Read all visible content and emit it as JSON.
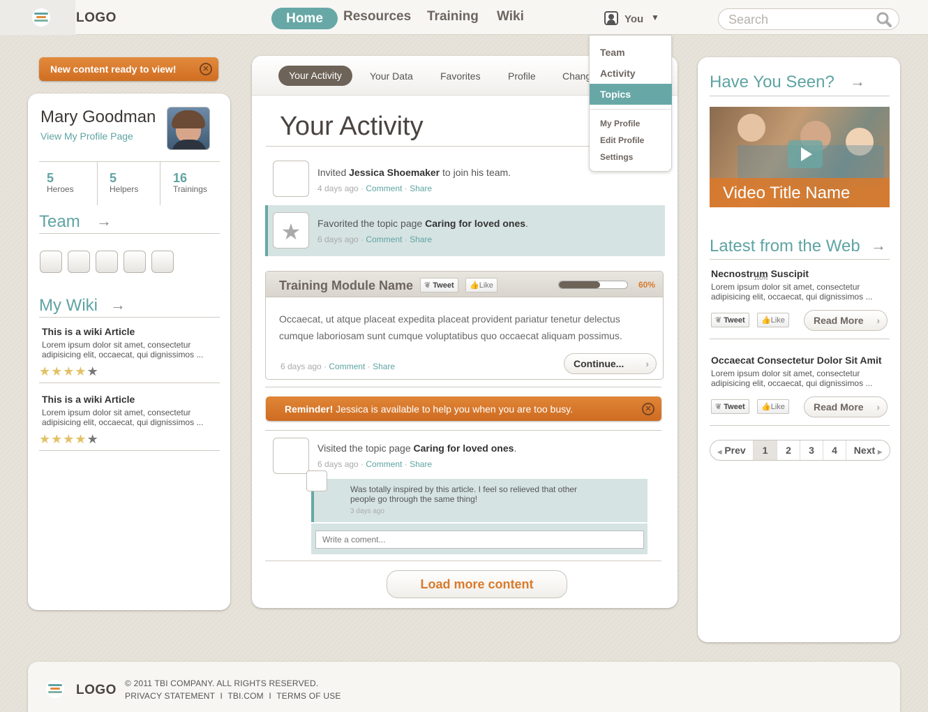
{
  "header": {
    "logo": "LOGO",
    "nav": [
      "Home",
      "Resources",
      "Training",
      "Wiki"
    ],
    "user": "You",
    "search_placeholder": "Search"
  },
  "dropdown": {
    "items": [
      "Team",
      "Activity",
      "Topics"
    ],
    "sub_items": [
      "My Profile",
      "Edit Profile",
      "Settings"
    ],
    "active": "Topics"
  },
  "notice": {
    "text": "New content ready to view!"
  },
  "profile": {
    "name": "Mary Goodman",
    "link": "View My Profile Page",
    "stats": [
      {
        "value": "5",
        "label": "Heroes"
      },
      {
        "value": "5",
        "label": "Helpers"
      },
      {
        "value": "16",
        "label": "Trainings"
      }
    ],
    "team_title": "Team",
    "wiki_title": "My Wiki",
    "wiki_articles": [
      {
        "title": "This is a wiki Article",
        "body": "Lorem ipsum dolor sit amet, consectetur adipisicing elit, occaecat, qui dignissimos ...",
        "rating": 4,
        "max": 5
      },
      {
        "title": "This is a wiki Article",
        "body": "Lorem ipsum dolor sit amet, consectetur adipisicing elit, occaecat, qui dignissimos ...",
        "rating": 4,
        "max": 5
      }
    ]
  },
  "tabs": [
    "Your Activity",
    "Your Data",
    "Favorites",
    "Profile",
    "Chang"
  ],
  "main": {
    "title": "Your Activity",
    "activity1": {
      "pre": "Invited ",
      "bold": "Jessica Shoemaker",
      "post": " to join his team.",
      "time": "4 days ago",
      "comment": "Comment",
      "share": "Share"
    },
    "activity2": {
      "pre": "Favorited the topic page ",
      "bold": "Caring for loved ones",
      "post": ".",
      "time": "6 days ago",
      "comment": "Comment",
      "share": "Share"
    },
    "training": {
      "title": "Training Module Name",
      "tweet": "Tweet",
      "like": "Like",
      "progress_label": "60%",
      "progress": 0.6,
      "body": "Occaecat, ut atque placeat expedita placeat provident pariatur tenetur delectus cumque laboriosam sunt cumque voluptatibus quo occaecat aliquam possimus.",
      "time": "6 days ago",
      "comment": "Comment",
      "share": "Share",
      "continue": "Continue..."
    },
    "reminder": {
      "bold": "Reminder!",
      "text": " Jessica is available to help you when you are too busy."
    },
    "activity3": {
      "pre": "Visited the topic page ",
      "bold": "Caring for loved ones",
      "post": ".",
      "time": "6 days ago",
      "comment": "Comment",
      "share": "Share"
    },
    "reply": {
      "text": "Was totally inspired by this article. I feel so relieved that other people go through the same thing!",
      "time": "3 days ago"
    },
    "comment_placeholder": "Write a coment...",
    "load_more": "Load more content"
  },
  "right": {
    "seen_title": "Have You Seen?",
    "video_title": "Video Title Name",
    "web_title": "Latest from the Web",
    "articles": [
      {
        "title": "Necnostrum Suscipit",
        "overlay": "100%",
        "body": "Lorem ipsum dolor sit amet, consectetur adipisicing elit, occaecat, qui dignissimos ...",
        "tweet": "Tweet",
        "like": "Like",
        "read": "Read More"
      },
      {
        "title": "Occaecat Consectetur Dolor Sit Amit",
        "body": "Lorem ipsum dolor sit amet, consectetur adipisicing elit, occaecat, qui dignissimos ...",
        "tweet": "Tweet",
        "like": "Like",
        "read": "Read More"
      }
    ],
    "pagination": [
      "Prev",
      "1",
      "2",
      "3",
      "4",
      "Next"
    ]
  },
  "footer": {
    "logo": "LOGO",
    "copyright": "© 2011 TBI COMPANY. ALL RIGHTS RESERVED.",
    "links": [
      "PRIVACY STATEMENT",
      "TBI.COM",
      "TERMS OF USE"
    ],
    "sep": "I"
  },
  "colors": {
    "accent": "#67a8a7",
    "orange": "#d87a2c",
    "bg": "#e7e3da"
  }
}
